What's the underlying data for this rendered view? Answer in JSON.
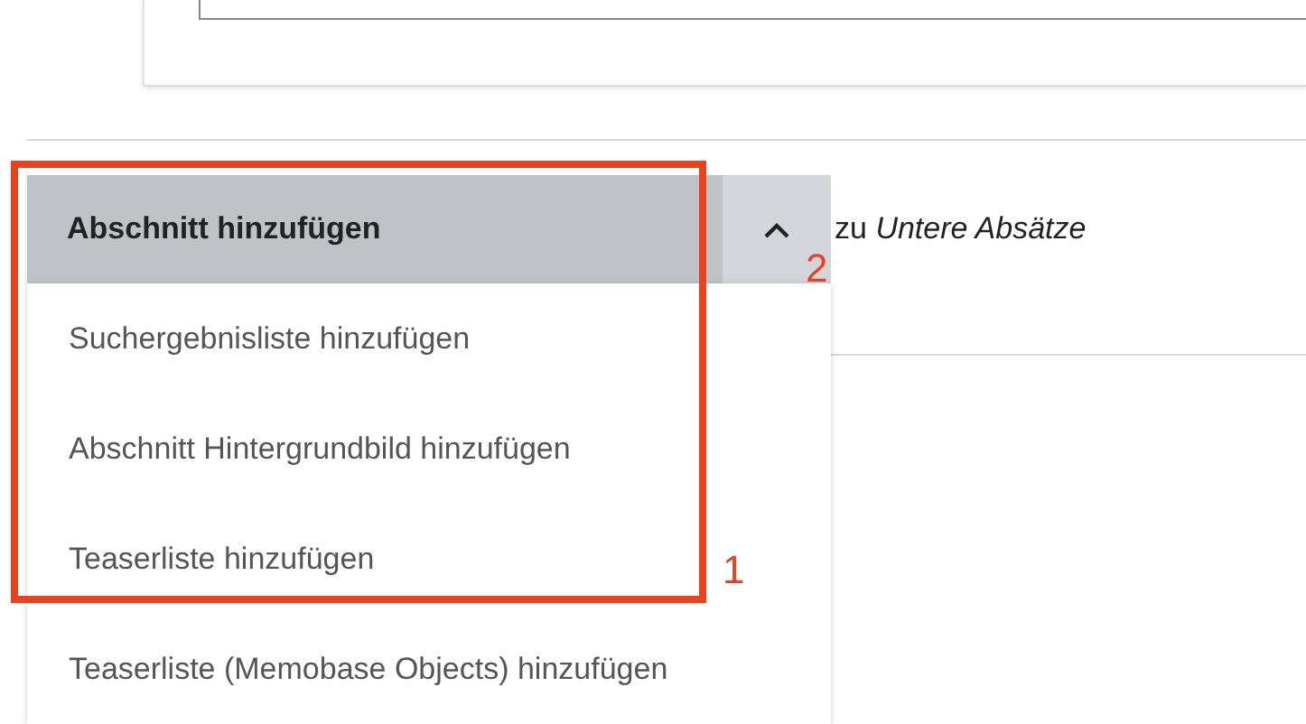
{
  "add_section": {
    "button_label": "Abschnitt hinzufügen",
    "expanded": true,
    "target_text": "zu *Untere Absätze*"
  },
  "menu_items": [
    {
      "label": "Suchergebnisliste hinzufügen"
    },
    {
      "label": "Abschnitt Hintergrundbild hinzufügen"
    },
    {
      "label": "Teaserliste hinzufügen"
    },
    {
      "label": "Teaserliste (Memobase Objects) hinzufügen"
    }
  ],
  "annotations": [
    {
      "label": "1"
    },
    {
      "label": "2"
    }
  ]
}
